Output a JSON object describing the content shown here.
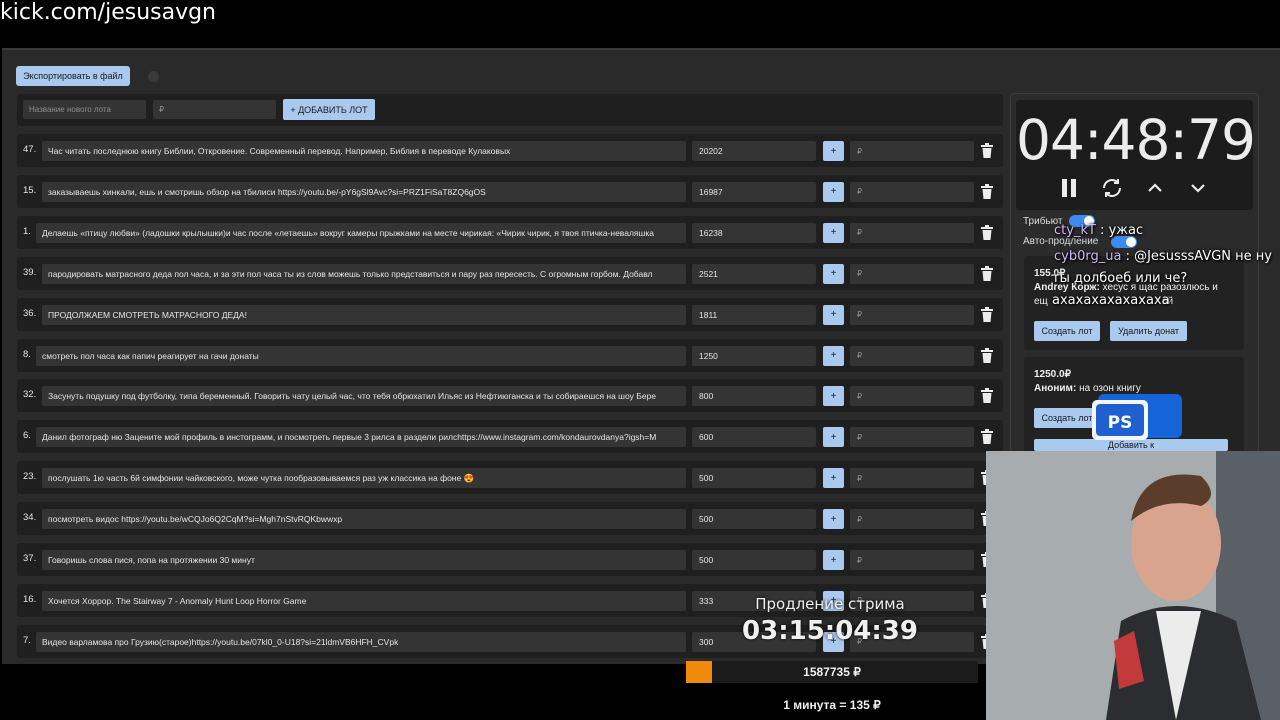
{
  "browser": {
    "url": "kick.com/jesusavgn"
  },
  "toolbar": {
    "export_label": "Экспортировать в файл"
  },
  "new_lot": {
    "name_placeholder": "Название нового лота",
    "amount_placeholder": "₽",
    "add_label": "+ ДОБАВИТЬ ЛОТ"
  },
  "lots": [
    {
      "num": "47.",
      "title": "Час читать последнюю книгу Библии, Откровение. Современный перевод. Например, Библия в переводе Кулаковых",
      "amount": "20202",
      "plus": "+",
      "rub": "₽"
    },
    {
      "num": "15.",
      "title": "заказываешь хинкали, ешь и смотришь обзор на тбилиси https://youtu.be/-pY6gSl9Avc?si=PRZ1FiSaT8ZQ6gOS",
      "amount": "16987",
      "plus": "+",
      "rub": "₽"
    },
    {
      "num": "1.",
      "title": "Делаешь «птицу любви» (ладошки крылышки)и час после «летаешь» вокруг камеры прыжками на месте чирикая: «Чирик чирик, я твоя птичка-неваляшка",
      "amount": "16238",
      "plus": "+",
      "rub": "₽"
    },
    {
      "num": "39.",
      "title": "пародировать матрасного деда пол часа, и за эти пол часа ты из слов можешь только представиться и пару раз пересесть. С огромным горбом. Добавл",
      "amount": "2521",
      "plus": "+",
      "rub": "₽"
    },
    {
      "num": "36.",
      "title": "ПРОДОЛЖАЕМ СМОТРЕТЬ МАТРАСНОГО ДЕДА!",
      "amount": "1811",
      "plus": "+",
      "rub": "₽"
    },
    {
      "num": "8.",
      "title": "смотреть пол часа как папич реагирует на гачи донаты",
      "amount": "1250",
      "plus": "+",
      "rub": "₽"
    },
    {
      "num": "32.",
      "title": "Засунуть подушку под футболку, типа беременный. Говорить чату целый час, что тебя обрюхатил Ильяс из Нефтиюганска и ты собираешся на шоу Бере",
      "amount": "800",
      "plus": "+",
      "rub": "₽"
    },
    {
      "num": "6.",
      "title": "Данил фотограф ню Зацените мой профиль в инстограмм, и посмотреть первые 3 рилса в раздели рилсhttps://www.instagram.com/kondaurovdanya?igsh=M",
      "amount": "600",
      "plus": "+",
      "rub": "₽"
    },
    {
      "num": "23.",
      "title": "послушать 1ю часть 6й симфонии чайковского, може чутка пообразовываемся раз уж классика на фоне 😍",
      "amount": "500",
      "plus": "+",
      "rub": "₽"
    },
    {
      "num": "34.",
      "title": "посмотреть видос https://youtu.be/wCQJo6Q2CqM?si=Mgh7nStvRQKbwwxp",
      "amount": "500",
      "plus": "+",
      "rub": "₽"
    },
    {
      "num": "37.",
      "title": "Говоришь слова пися, попа на протяжении 30 минут",
      "amount": "500",
      "plus": "+",
      "rub": "₽"
    },
    {
      "num": "16.",
      "title": "Хочется Хоррор. The Stairway 7 - Anomaly Hunt Loop Horror Game",
      "amount": "333",
      "plus": "+",
      "rub": "₽"
    },
    {
      "num": "7.",
      "title": "Видео варламова про Грузию(старое)https://youtu.be/07kl0_0-U18?si=21ldmVB6HFH_CVpk",
      "amount": "300",
      "plus": "+",
      "rub": "₽"
    }
  ],
  "timer": {
    "value": "04:48:79",
    "tribute_label": "Трибьют",
    "auto_extend_label": "Авто-продление"
  },
  "donations": [
    {
      "amount": "155.0₽",
      "author": "Andrey Корж:",
      "text": "хесус я щас разозлюсь и",
      "text2": "ещ",
      "text3": "ай",
      "create_label": "Создать лот",
      "delete_label": "Удалить донат"
    },
    {
      "amount": "1250.0₽",
      "author": "Аноним:",
      "text": "на озон книгу",
      "create_label": "Создать лот",
      "add_label": "Добавить к "
    }
  ],
  "chat": [
    {
      "user": "cty_kT",
      "sep": " : ",
      "text": "ужас"
    },
    {
      "user": "cyb0rg_ua",
      "sep": " : ",
      "text": "@JesusssAVGN не ну"
    },
    {
      "user": "",
      "sep": "",
      "text": "ты долбоеб или че?"
    },
    {
      "user": "",
      "sep": "",
      "text": "ахахахахахахаха"
    }
  ],
  "overlay": {
    "extension_label": "Продление стрима",
    "extension_timer": "03:15:04:39",
    "total": "1587735 ₽",
    "progress_fraction": 0.09,
    "rate": "1 минута = 135 ₽",
    "ps_text": "PS"
  },
  "colors": {
    "accent": "#a9c9ef",
    "toggle": "#3d8bef",
    "progress": "#f08a0c",
    "chat_user": "#cbb7f5"
  }
}
